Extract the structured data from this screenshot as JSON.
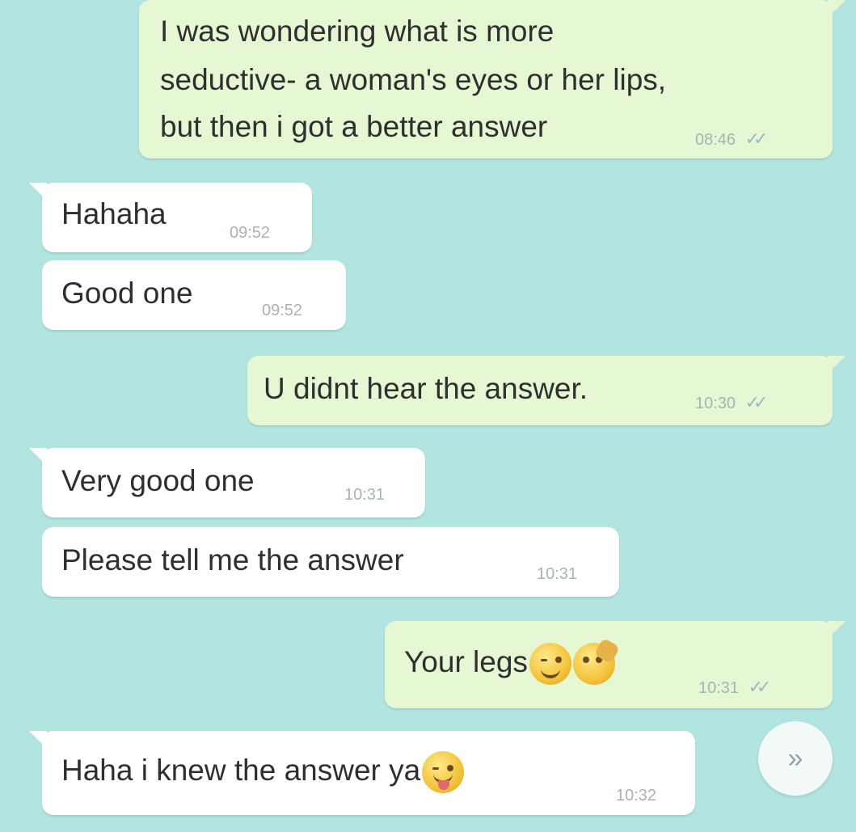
{
  "chat": {
    "messages": [
      {
        "direction": "outgoing",
        "lines": [
          "I was wondering what is more",
          "seductive- a woman's eyes or her lips,",
          "but then i got a better answer"
        ],
        "time": "08:46",
        "status_icon": "double-check-icon"
      },
      {
        "direction": "incoming",
        "text": "Hahaha",
        "time": "09:52"
      },
      {
        "direction": "incoming",
        "text": "Good one",
        "time": "09:52"
      },
      {
        "direction": "outgoing",
        "text": "U didnt hear the answer.",
        "time": "10:30",
        "status_icon": "double-check-icon"
      },
      {
        "direction": "incoming",
        "text": "Very good one",
        "time": "10:31"
      },
      {
        "direction": "incoming",
        "text": "Please tell me the answer",
        "time": "10:31"
      },
      {
        "direction": "outgoing",
        "text": "Your legs",
        "emojis": [
          "winking-face-emoji",
          "face-with-hand-over-mouth-emoji"
        ],
        "time": "10:31",
        "status_icon": "double-check-icon"
      },
      {
        "direction": "incoming",
        "text": "Haha i knew the answer ya",
        "emojis": [
          "winking-face-with-tongue-emoji"
        ],
        "time": "10:32"
      }
    ]
  },
  "scroll_button": {
    "icon": "double-chevron-down-icon"
  },
  "colors": {
    "background": "#b2e4e0",
    "outgoing_bubble": "#e6f7d3",
    "incoming_bubble": "#ffffff",
    "tick": "#9fb6c4"
  }
}
